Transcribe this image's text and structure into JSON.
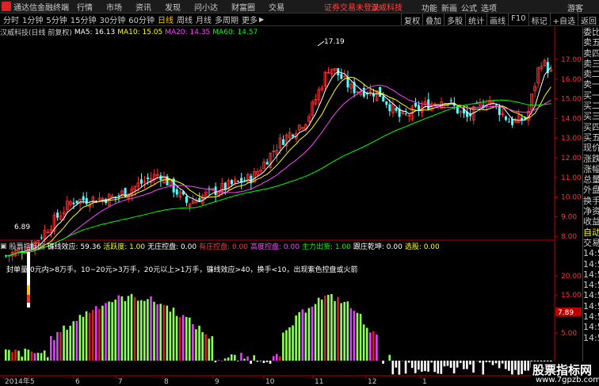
{
  "menubar": {
    "app_title": "通达信金融终端",
    "items": [
      "行情",
      "市场",
      "资讯",
      "发现",
      "问小达",
      "财富圈",
      "交易"
    ],
    "notice": "证券交易未登录",
    "stock_name": "汉威科技",
    "right_items": [
      "功能",
      "新画",
      "公式",
      "选项",
      "游客"
    ]
  },
  "toolbar": {
    "periods": [
      "分时",
      "1分钟",
      "5分钟",
      "15分钟",
      "30分钟",
      "60分钟",
      "日线",
      "周线",
      "月线",
      "多周期",
      "更多"
    ],
    "active_period": "日线",
    "right_buttons": [
      "复权",
      "叠加",
      "多股",
      "统计",
      "画线",
      "F10",
      "标记",
      "+自选",
      "返回"
    ]
  },
  "info_bar": {
    "title": "汉威科技(日线 前复权)",
    "ma_items": [
      {
        "label": "MA5: 16.13",
        "color": "#ffffff"
      },
      {
        "label": "MA10: 15.05",
        "color": "#ffff00"
      },
      {
        "label": "MA20: 14.35",
        "color": "#ff44ff"
      },
      {
        "label": "MA60: 14.57",
        "color": "#00ff00"
      }
    ]
  },
  "price_axis": [
    "17.00",
    "16.00",
    "15.00",
    "14.00",
    "13.00",
    "12.00",
    "11.00",
    "10.00",
    "9.00",
    "8.00"
  ],
  "price_marks": {
    "high": "17.19",
    "low": "6.89"
  },
  "indicator_bar": {
    "title": "股票指标网",
    "items": [
      {
        "label": "镰线效应: 59.36",
        "color": "#ffffff"
      },
      {
        "label": "活跃度: 1.00",
        "color": "#ffff00"
      },
      {
        "label": "无庄控盘: 0.00",
        "color": "#ffffff"
      },
      {
        "label": "有庄控盘: 0.00",
        "color": "#ff3333"
      },
      {
        "label": "高度控盘: 0.00",
        "color": "#ff44ff"
      },
      {
        "label": "主力出货: 1.00",
        "color": "#00ff00"
      },
      {
        "label": "跟庄乾坤: 0.00",
        "color": "#ffffff"
      },
      {
        "label": "选股: 0.00",
        "color": "#ffff00"
      }
    ]
  },
  "indicator_note": "封单量:0元内>8万手。10~20元>3万手，20元以上>1万手，镰线效应>40，换手<10，出现紫色控盘或火箭",
  "indicator_axis": [
    "20.00",
    "15.00",
    "10.00",
    "5.00"
  ],
  "indicator_value": "7.89",
  "date_axis": [
    "2014年",
    "5",
    "6",
    "7",
    "8",
    "9",
    "10",
    "11",
    "12",
    "1"
  ],
  "right_panel": [
    "委比",
    "卖五",
    "卖四",
    "卖三",
    "卖二",
    "卖一",
    "买一",
    "买二",
    "买三",
    "买四",
    "买五",
    "现价",
    "涨跌",
    "涨幅",
    "总量",
    "外盘",
    "换手",
    "净资",
    "收益",
    "自动",
    "交易",
    "14:50",
    "14:50",
    "14:50",
    "14:50",
    "14:50",
    "14:50",
    "14:50",
    "14:50",
    "14:50"
  ],
  "watermark": {
    "line1": "股票指标网",
    "line2": "www.7gpzb.com"
  },
  "colors": {
    "up": "#ff3333",
    "down": "#54ffff",
    "ma5": "#ffffff",
    "ma10": "#ffff00",
    "ma20": "#ff44ff",
    "ma60": "#00ff00"
  }
}
